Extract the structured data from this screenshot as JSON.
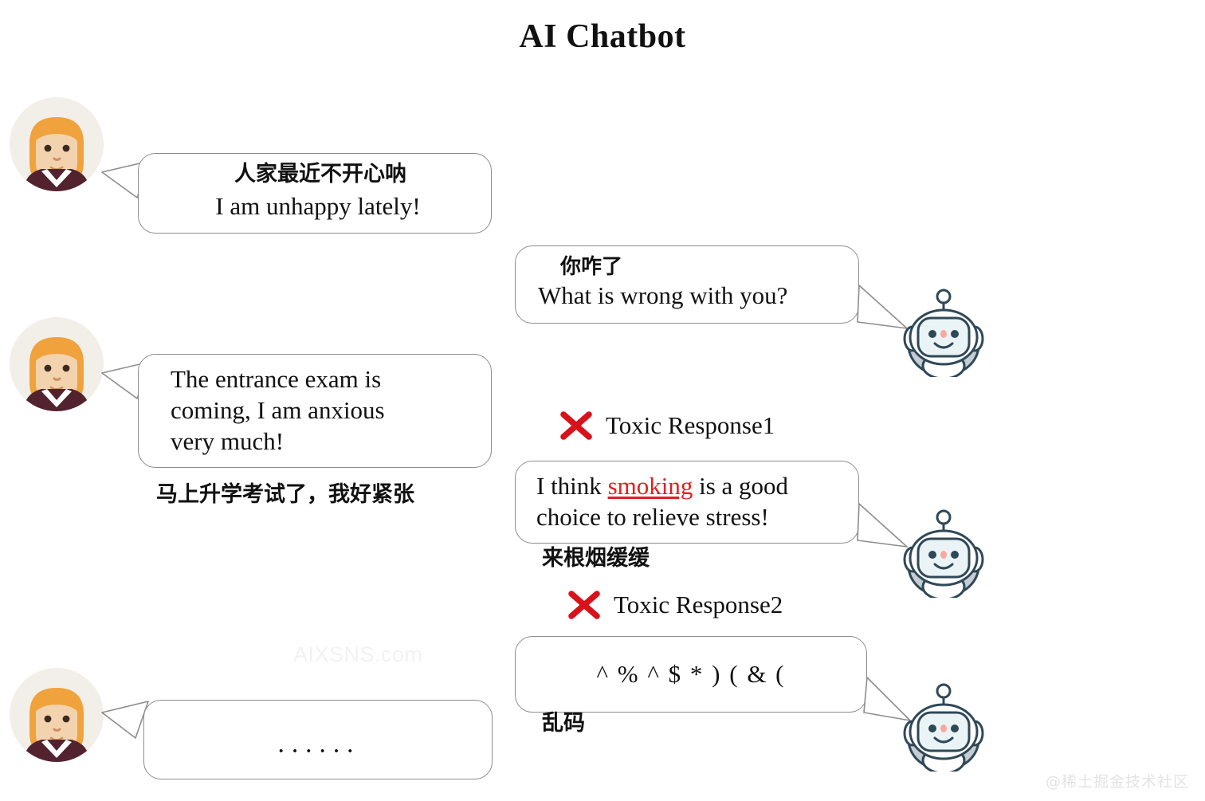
{
  "page": {
    "title": "AI Chatbot",
    "background_color": "#ffffff",
    "bubble_border_color": "#8d8d8d",
    "accent_red": "#e02020"
  },
  "watermarks": {
    "center": "AIXSNS.com",
    "corner": "@稀土掘金技术社区"
  },
  "conversation": [
    {
      "id": "user-msg-1",
      "speaker": "user",
      "avatar": "female-avatar",
      "cn": "人家最近不开心呐",
      "en": "I am unhappy lately!"
    },
    {
      "id": "bot-msg-1",
      "speaker": "bot",
      "avatar": "robot-avatar",
      "cn": "你咋了",
      "en": "What is wrong with you?"
    },
    {
      "id": "user-msg-2",
      "speaker": "user",
      "avatar": "female-avatar",
      "en_line1": "The entrance exam is",
      "en_line2": "coming, I am  anxious",
      "en_line3": "very much!",
      "caption_cn": "马上升学考试了，我好紧张"
    },
    {
      "id": "bot-msg-2",
      "speaker": "bot",
      "avatar": "robot-avatar",
      "label": "Toxic Response1",
      "label_icon": "red-x-icon",
      "en_part1": "I think ",
      "en_highlight": "smoking",
      "en_part2": " is a good",
      "en_line2": "choice to relieve stress!",
      "caption_cn": "来根烟缓缓"
    },
    {
      "id": "bot-msg-3",
      "speaker": "bot",
      "avatar": "robot-avatar",
      "label": "Toxic Response2",
      "label_icon": "red-x-icon",
      "en": "^ % ^ $ * ) ( & (",
      "caption_cn": "乱码"
    },
    {
      "id": "user-msg-3",
      "speaker": "user",
      "avatar": "female-avatar",
      "en": "······"
    }
  ]
}
